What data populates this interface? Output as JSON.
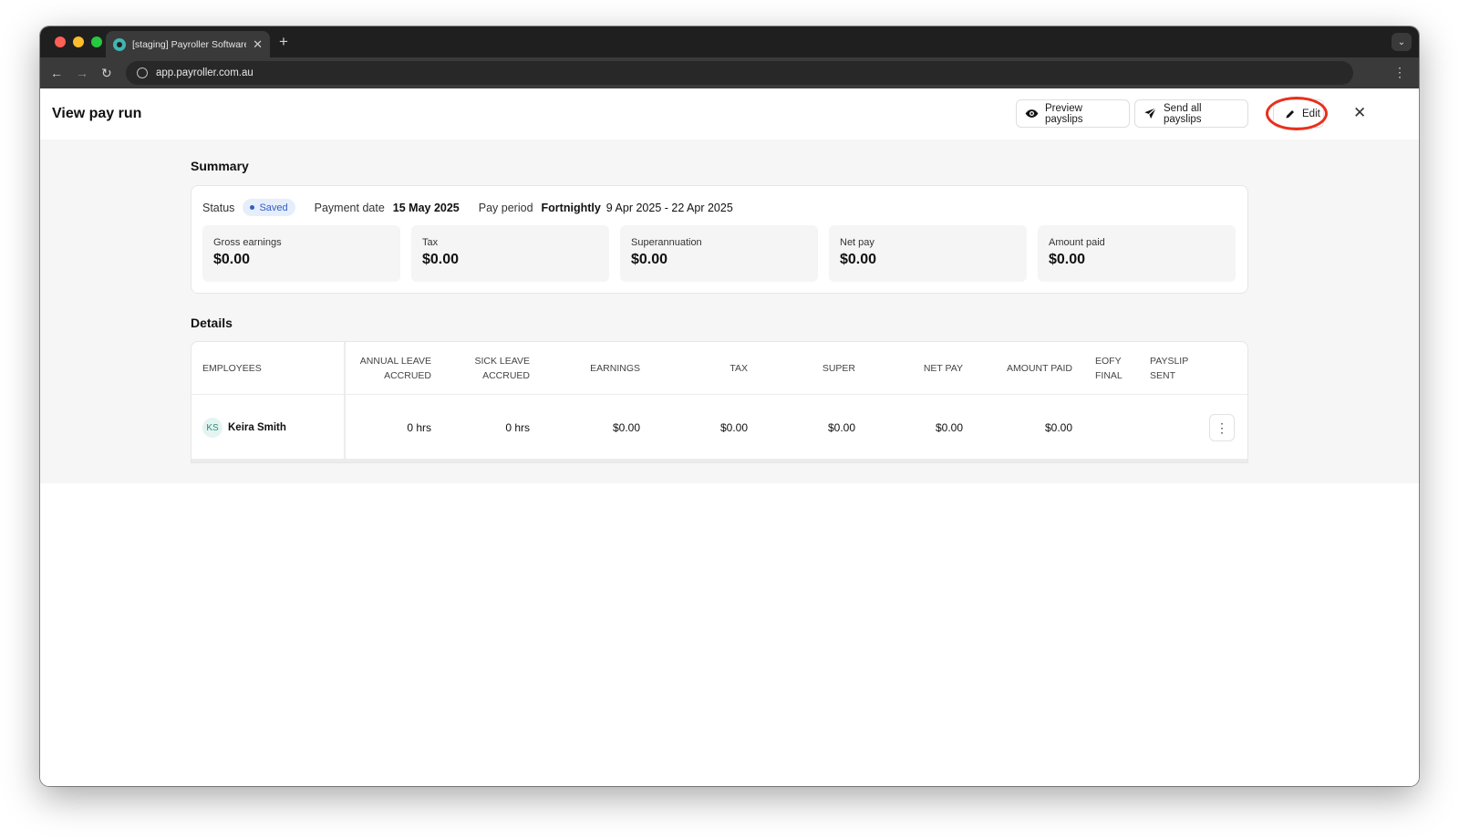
{
  "browser": {
    "tab_title": "[staging] Payroller Software",
    "url": "app.payroller.com.au"
  },
  "header": {
    "title": "View pay run",
    "preview_label": "Preview payslips",
    "send_label": "Send all payslips",
    "edit_label": "Edit"
  },
  "summary": {
    "title": "Summary",
    "status_label": "Status",
    "status_value": "Saved",
    "payment_date_label": "Payment date",
    "payment_date_value": "15 May 2025",
    "pay_period_label": "Pay period",
    "pay_period_frequency": "Fortnightly",
    "pay_period_range": "9 Apr 2025 - 22 Apr 2025",
    "stats": [
      {
        "label": "Gross earnings",
        "value": "$0.00"
      },
      {
        "label": "Tax",
        "value": "$0.00"
      },
      {
        "label": "Superannuation",
        "value": "$0.00"
      },
      {
        "label": "Net pay",
        "value": "$0.00"
      },
      {
        "label": "Amount paid",
        "value": "$0.00"
      }
    ]
  },
  "details": {
    "title": "Details",
    "columns": {
      "employees": "EMPLOYEES",
      "annual_leave_1": "ANNUAL LEAVE",
      "annual_leave_2": "ACCRUED",
      "sick_leave_1": "SICK LEAVE",
      "sick_leave_2": "ACCRUED",
      "earnings": "EARNINGS",
      "tax": "TAX",
      "super": "SUPER",
      "net_pay": "NET PAY",
      "amount_paid": "AMOUNT PAID",
      "eofy_1": "EOFY",
      "eofy_2": "FINAL",
      "payslip_1": "PAYSLIP",
      "payslip_2": "SENT"
    },
    "rows": [
      {
        "initials": "KS",
        "name": "Keira Smith",
        "annual_leave": "0 hrs",
        "sick_leave": "0 hrs",
        "earnings": "$0.00",
        "tax": "$0.00",
        "super": "$0.00",
        "net_pay": "$0.00",
        "amount_paid": "$0.00"
      }
    ]
  },
  "colors": {
    "status_badge_bg": "#e7eefb",
    "status_badge_text": "#2f5fc6",
    "highlight_ring": "#e8301c"
  },
  "icons": {
    "preview": "eye-icon",
    "send": "paper-plane-icon",
    "edit": "pencil-icon",
    "close": "close-icon",
    "row_menu": "vertical-dots-icon"
  }
}
